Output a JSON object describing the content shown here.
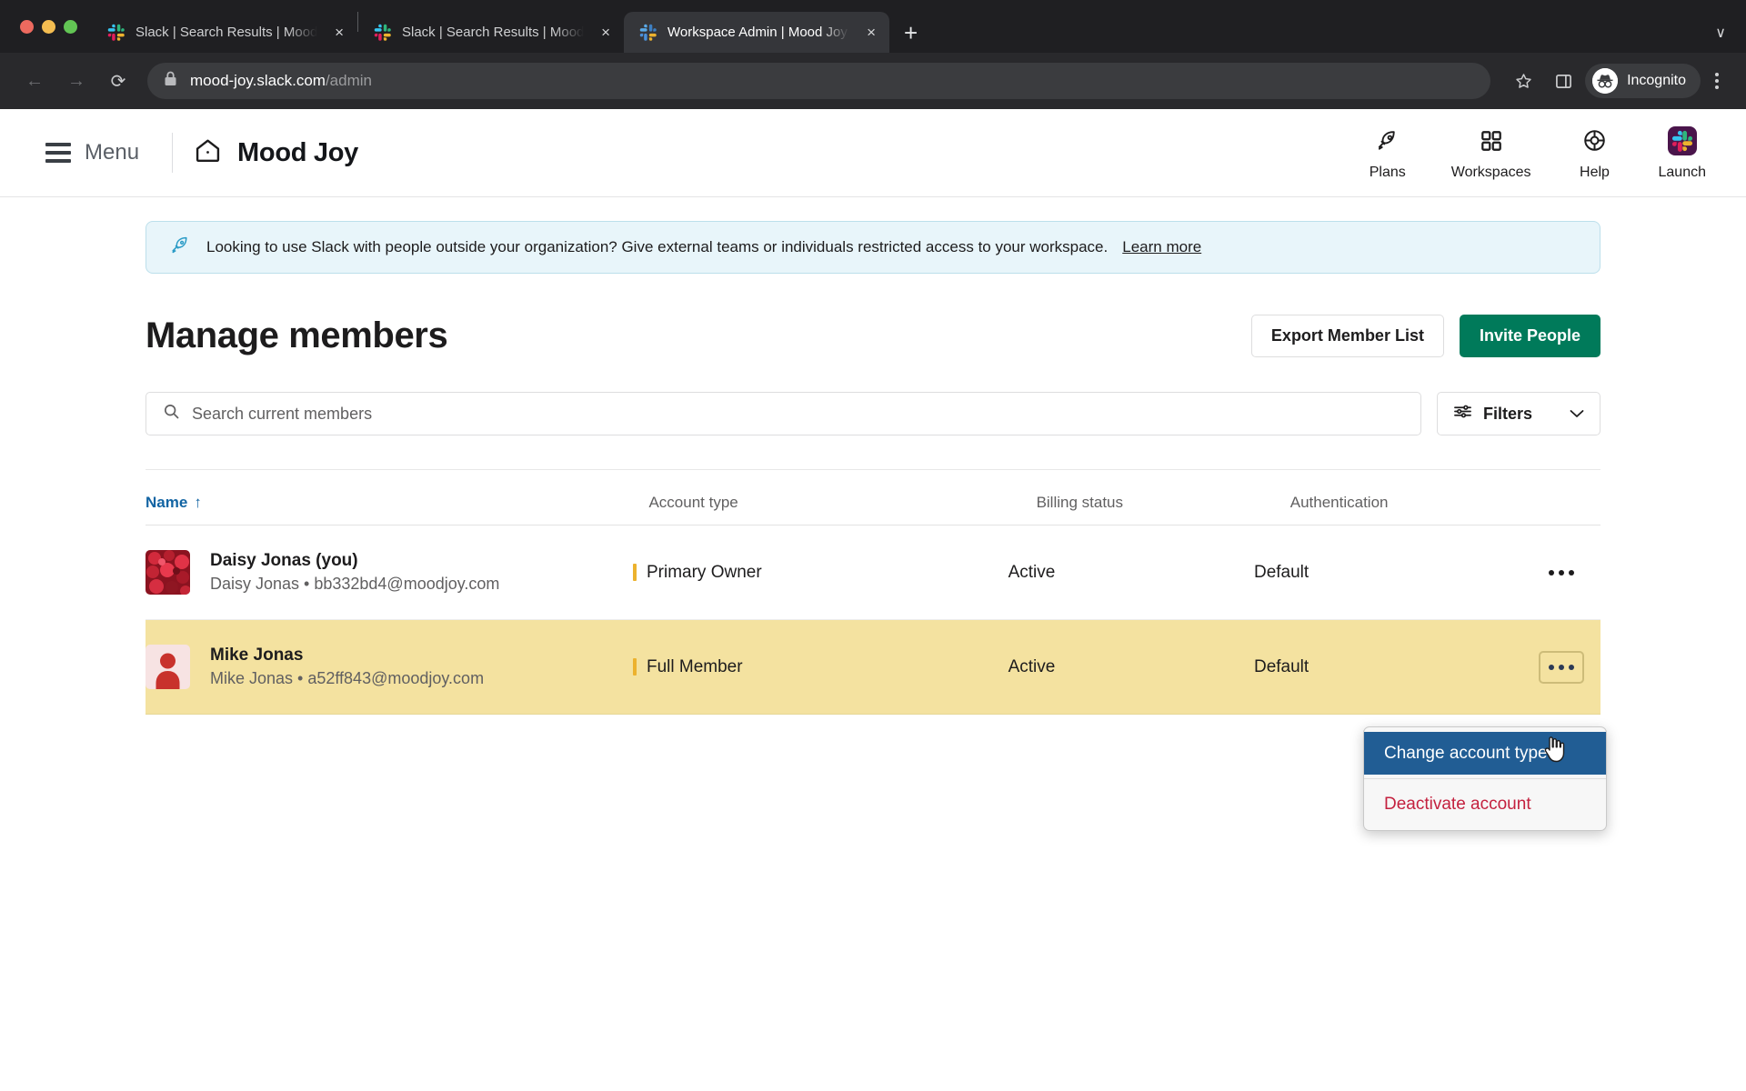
{
  "browser": {
    "tabs": [
      {
        "title": "Slack | Search Results | Mood ",
        "favicon": "slack-icon",
        "active": false,
        "close": "×"
      },
      {
        "title": "Slack | Search Results | Mood ",
        "favicon": "slack-icon",
        "active": false,
        "close": "×"
      },
      {
        "title": "Workspace Admin | Mood Joy S",
        "favicon": "slack-icon",
        "active": true,
        "close": "×"
      }
    ],
    "new_tab_label": "+",
    "tabstrip_chevron": "∨",
    "nav": {
      "back": "←",
      "forward": "→",
      "reload": "⟳"
    },
    "omnibox": {
      "lock_icon": "lock-icon",
      "url_host": "mood-joy.slack.com",
      "url_path": "/admin"
    },
    "right": {
      "bookmark_icon": "star-icon",
      "sidepanel_icon": "side-panel-icon",
      "profile_label": "Incognito",
      "menu_icon": "kebab-menu-icon"
    }
  },
  "appbar": {
    "menu_label": "Menu",
    "home_icon": "home-icon",
    "brand": "Mood Joy",
    "nav_items": [
      {
        "label": "Plans",
        "icon": "rocket-icon"
      },
      {
        "label": "Workspaces",
        "icon": "grid-squares-icon"
      },
      {
        "label": "Help",
        "icon": "lifebuoy-icon"
      },
      {
        "label": "Launch",
        "icon": "slack-launch-icon"
      }
    ]
  },
  "banner": {
    "icon": "rocket-icon",
    "text": "Looking to use Slack with people outside your organization? Give external teams or individuals restricted access to your workspace.",
    "link_label": "Learn more"
  },
  "main": {
    "title": "Manage members",
    "export_button": "Export Member List",
    "invite_button": "Invite People",
    "search": {
      "placeholder": "Search current members",
      "value": "",
      "icon": "search-icon"
    },
    "filters": {
      "label": "Filters",
      "icon": "sliders-icon",
      "chevron": "⌄"
    }
  },
  "table": {
    "columns": [
      {
        "key": "name",
        "label": "Name",
        "sort": "↑",
        "sorted": true
      },
      {
        "key": "account_type",
        "label": "Account type"
      },
      {
        "key": "billing_status",
        "label": "Billing status"
      },
      {
        "key": "authentication",
        "label": "Authentication"
      }
    ],
    "rows": [
      {
        "name": "Daisy Jonas (you)",
        "subtitle": "Daisy Jonas • bb332bd4@moodjoy.com",
        "account_type": "Primary Owner",
        "billing_status": "Active",
        "authentication": "Default",
        "avatar": "photo-avatar-flowers",
        "highlighted": false,
        "menu_icon": "ellipsis-icon",
        "menu_focused": false
      },
      {
        "name": "Mike Jonas",
        "subtitle": "Mike Jonas • a52ff843@moodjoy.com",
        "account_type": "Full Member",
        "billing_status": "Active",
        "authentication": "Default",
        "avatar": "person-avatar-red",
        "highlighted": true,
        "menu_icon": "ellipsis-icon",
        "menu_focused": true
      }
    ]
  },
  "context_menu": {
    "items": [
      {
        "label": "Change account type",
        "state": "selected"
      },
      {
        "label": "Deactivate account",
        "state": "danger"
      }
    ]
  },
  "colors": {
    "accent_green": "#007a5a",
    "link_blue": "#1264a3",
    "menu_selected_blue": "#215d94",
    "danger_red": "#c4213f",
    "row_highlight": "#f4e2a0",
    "banner_bg": "#e8f5fa",
    "account_bar": "#ecb22e",
    "slack_purple": "#4a154b"
  }
}
